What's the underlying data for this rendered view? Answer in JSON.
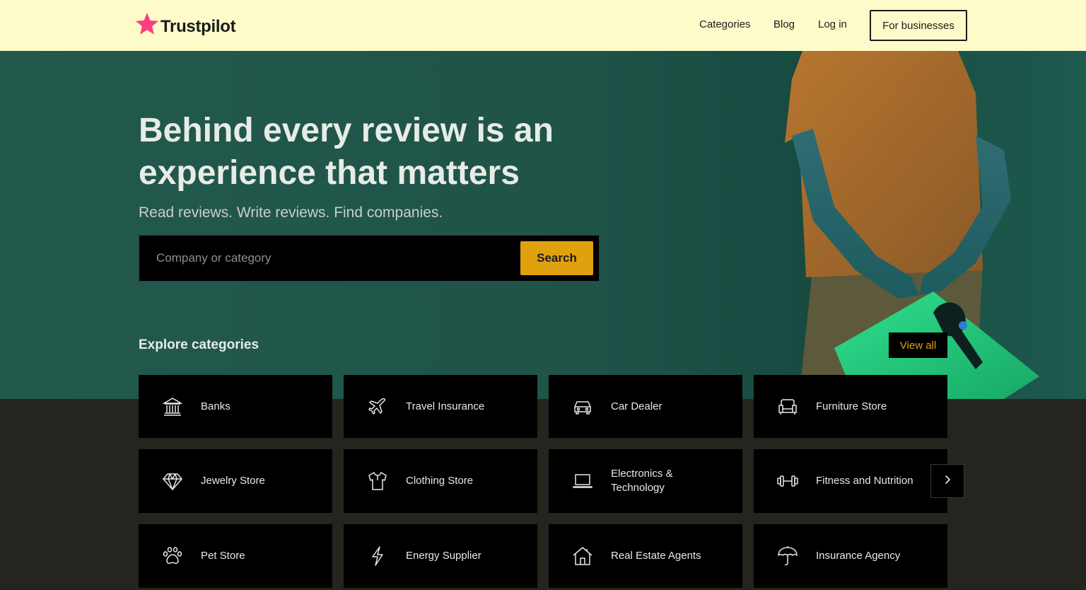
{
  "header": {
    "logo_text": "Trustpilot",
    "nav": {
      "categories": "Categories",
      "blog": "Blog",
      "login": "Log in"
    },
    "business_button": "For businesses"
  },
  "hero": {
    "headline": "Behind every review is an experience that matters",
    "subline": "Read reviews. Write reviews. Find companies.",
    "search": {
      "placeholder": "Company or category",
      "button": "Search"
    }
  },
  "explore": {
    "title": "Explore categories",
    "view_all": "View all",
    "categories": [
      {
        "label": "Banks",
        "icon": "bank-icon"
      },
      {
        "label": "Travel Insurance",
        "icon": "airplane-icon"
      },
      {
        "label": "Car Dealer",
        "icon": "car-icon"
      },
      {
        "label": "Furniture Store",
        "icon": "sofa-icon"
      },
      {
        "label": "Jewelry Store",
        "icon": "diamond-icon"
      },
      {
        "label": "Clothing Store",
        "icon": "shirt-icon"
      },
      {
        "label": "Electronics & Technology",
        "icon": "laptop-icon"
      },
      {
        "label": "Fitness and Nutrition",
        "icon": "dumbbell-icon"
      },
      {
        "label": "Pet Store",
        "icon": "paw-icon"
      },
      {
        "label": "Energy Supplier",
        "icon": "lightning-icon"
      },
      {
        "label": "Real Estate Agents",
        "icon": "house-icon"
      },
      {
        "label": "Insurance Agency",
        "icon": "umbrella-icon"
      }
    ]
  },
  "colors": {
    "header_bg": "#fcfbc9",
    "hero_bg": "#23594d",
    "page_bg": "#25251f",
    "accent": "#e1a10e",
    "logo_star": "#ff3d7f"
  }
}
